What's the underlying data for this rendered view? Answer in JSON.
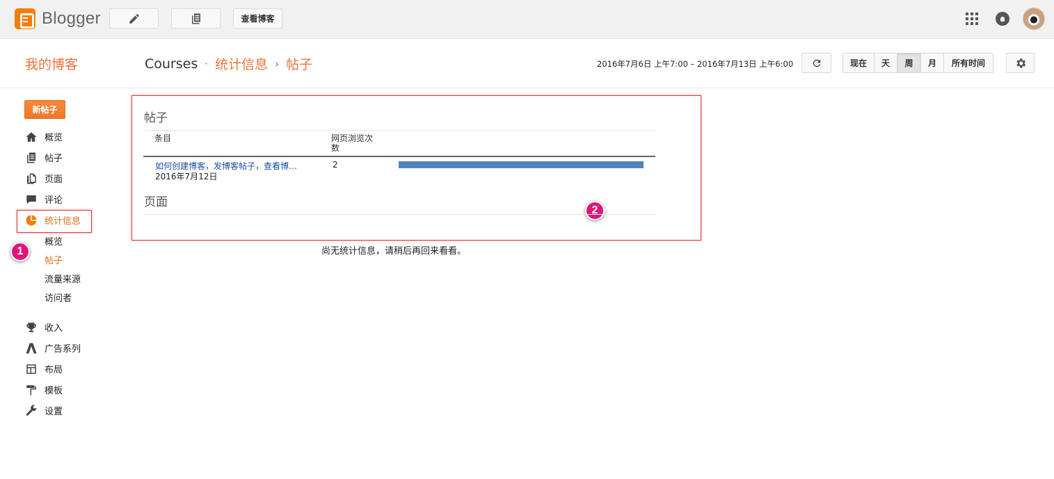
{
  "app": {
    "name": "Blogger",
    "view_blog_label": "查看博客"
  },
  "header": {
    "blog_title": "我的博客",
    "breadcrumb": [
      "Courses",
      "统计信息",
      "帖子"
    ],
    "breadcrumb_seps": [
      "·",
      "›"
    ],
    "date_range": "2016年7月6日 上午7:00 – 2016年7月13日 上午6:00",
    "range_buttons": [
      {
        "label": "现在",
        "active": false
      },
      {
        "label": "天",
        "active": false
      },
      {
        "label": "周",
        "active": true
      },
      {
        "label": "月",
        "active": false
      },
      {
        "label": "所有时间",
        "active": false
      }
    ]
  },
  "sidebar": {
    "new_post_label": "新帖子",
    "items": [
      {
        "label": "概览",
        "icon": "home-icon"
      },
      {
        "label": "帖子",
        "icon": "posts-icon"
      },
      {
        "label": "页面",
        "icon": "pages-icon"
      },
      {
        "label": "评论",
        "icon": "comment-icon"
      },
      {
        "label": "统计信息",
        "icon": "pie-chart-icon",
        "active": true
      },
      {
        "label": "收入",
        "icon": "trophy-icon"
      },
      {
        "label": "广告系列",
        "icon": "adwords-icon"
      },
      {
        "label": "布局",
        "icon": "layout-icon"
      },
      {
        "label": "模板",
        "icon": "paint-roller-icon"
      },
      {
        "label": "设置",
        "icon": "wrench-icon"
      }
    ],
    "stats_sub": [
      {
        "label": "概览",
        "active": false
      },
      {
        "label": "帖子",
        "active": true
      },
      {
        "label": "流量来源",
        "active": false
      },
      {
        "label": "访问者",
        "active": false
      }
    ]
  },
  "main": {
    "posts_section": {
      "title": "帖子",
      "col_entry": "条目",
      "col_views_line1": "网页浏览次",
      "col_views_line2": "数",
      "rows": [
        {
          "title": "如何创建博客，发博客帖子，查看博…",
          "date": "2016年7月12日",
          "views": "2",
          "bar_fraction": 1.0
        }
      ]
    },
    "pages_section": {
      "title": "页面",
      "empty_message": "尚无统计信息，请稍后再回来看看。"
    }
  },
  "annotations": {
    "badge1": "1",
    "badge2": "2",
    "highlight_color": "#e03a3a",
    "badge_color": "#e0157c"
  },
  "colors": {
    "accent": "#f57d00",
    "link": "#1a4fa0",
    "bar": "#4f82c0"
  }
}
